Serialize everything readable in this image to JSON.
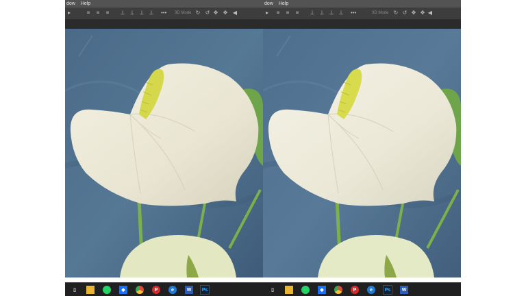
{
  "left": {
    "menu": [
      "dow",
      "Help"
    ],
    "options_label": "3D Mode",
    "taskbar": [
      {
        "icon": "task-view-icon",
        "color": "#202020",
        "glyph": "▯"
      },
      {
        "icon": "file-explorer-icon",
        "color": "#e8b632",
        "glyph": ""
      },
      {
        "icon": "whatsapp-icon",
        "color": "#25d366",
        "glyph": ""
      },
      {
        "icon": "dropbox-icon",
        "color": "#1b6ff5",
        "glyph": "◆"
      },
      {
        "icon": "chrome-icon",
        "color": "#e04a3a",
        "glyph": ""
      },
      {
        "icon": "pinterest-icon",
        "color": "#d72a2a",
        "glyph": "P"
      },
      {
        "icon": "edge-icon",
        "color": "#1f7bd8",
        "glyph": "e"
      },
      {
        "icon": "word-icon",
        "color": "#2b5cb8",
        "glyph": "W"
      },
      {
        "icon": "photoshop-icon",
        "color": "#0d2238",
        "glyph": "Ps",
        "active": true
      }
    ]
  },
  "right": {
    "menu": [
      "dow",
      "Help"
    ],
    "options_label": "3D Mode",
    "taskbar": [
      {
        "icon": "task-view-icon",
        "color": "#202020",
        "glyph": "▯"
      },
      {
        "icon": "file-explorer-icon",
        "color": "#e8b632",
        "glyph": ""
      },
      {
        "icon": "whatsapp-icon",
        "color": "#25d366",
        "glyph": ""
      },
      {
        "icon": "dropbox-icon",
        "color": "#1b6ff5",
        "glyph": "◆"
      },
      {
        "icon": "chrome-icon",
        "color": "#e04a3a",
        "glyph": ""
      },
      {
        "icon": "pinterest-icon",
        "color": "#d72a2a",
        "glyph": "P"
      },
      {
        "icon": "edge-icon",
        "color": "#1f7bd8",
        "glyph": "e"
      },
      {
        "icon": "photoshop-icon",
        "color": "#0d2238",
        "glyph": "Ps",
        "active": true
      },
      {
        "icon": "word-icon",
        "color": "#2b5cb8",
        "glyph": "W"
      }
    ]
  },
  "colors": {
    "background_blue": "#4f6f8c",
    "flower_spathe": "#ece8d6",
    "spadix": "#d4d84a",
    "stem_green": "#7bb04a"
  }
}
